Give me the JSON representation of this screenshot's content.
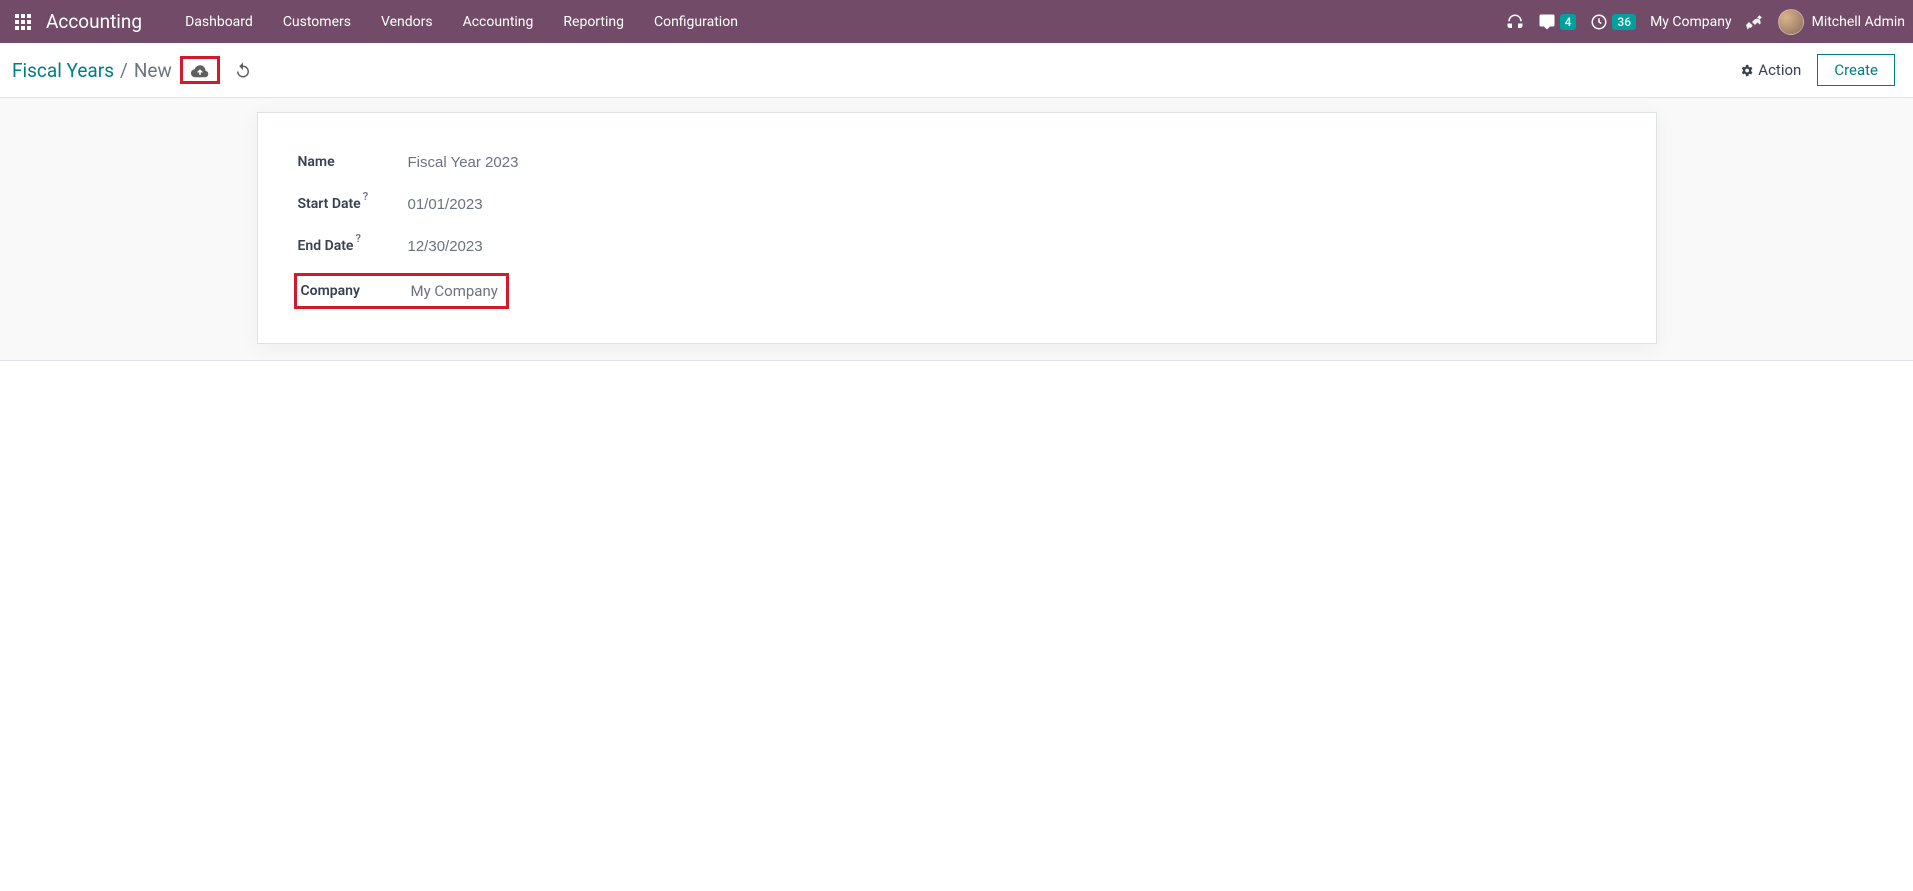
{
  "navbar": {
    "app_name": "Accounting",
    "menu": [
      "Dashboard",
      "Customers",
      "Vendors",
      "Accounting",
      "Reporting",
      "Configuration"
    ],
    "messages_badge": "4",
    "activities_badge": "36",
    "company": "My Company",
    "user": "Mitchell Admin"
  },
  "breadcrumb": {
    "parent": "Fiscal Years",
    "current": "New"
  },
  "controlbar": {
    "action_label": "Action",
    "create_label": "Create"
  },
  "form": {
    "name_label": "Name",
    "name_value": "Fiscal Year 2023",
    "start_date_label": "Start Date",
    "start_date_value": "01/01/2023",
    "end_date_label": "End Date",
    "end_date_value": "12/30/2023",
    "company_label": "Company",
    "company_value": "My Company"
  }
}
